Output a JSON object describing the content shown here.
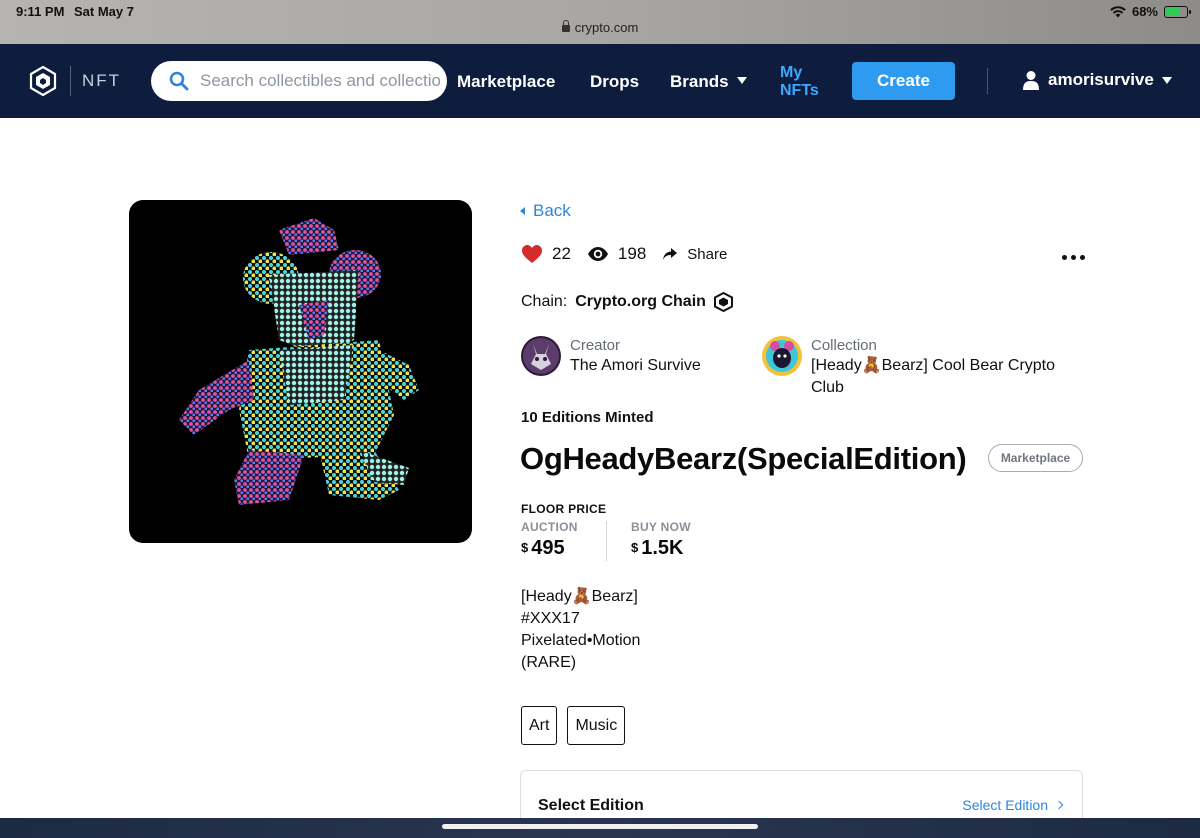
{
  "status_bar": {
    "time": "9:11 PM",
    "date": "Sat May 7",
    "url": "crypto.com",
    "battery": "68%",
    "battery_level": 0.68
  },
  "nav": {
    "brand": "NFT",
    "search_placeholder": "Search collectibles and collections",
    "links": {
      "marketplace": "Marketplace",
      "drops": "Drops",
      "brands": "Brands",
      "my_nfts": "My NFTs"
    },
    "create_label": "Create",
    "username": "amorisurvive"
  },
  "nft": {
    "back_label": "Back",
    "likes": "22",
    "views": "198",
    "share_label": "Share",
    "chain_label": "Chain:",
    "chain_value": "Crypto.org Chain",
    "creator_role": "Creator",
    "creator_name": "The Amori Survive",
    "collection_role": "Collection",
    "collection_name": "[Heady🧸Bearz] Cool Bear Crypto Club",
    "editions_minted": "10 Editions Minted",
    "title": "OgHeadyBearz(SpecialEdition)",
    "badge": "Marketplace",
    "floor_price_label": "FLOOR PRICE",
    "auction_label": "AUCTION",
    "auction_currency": "$",
    "auction_value": "495",
    "buy_now_label": "BUY NOW",
    "buy_now_currency": "$",
    "buy_now_value": "1.5K",
    "description": [
      "[Heady🧸Bearz]",
      "#XXX17",
      "Pixelated•Motion",
      "(RARE)"
    ],
    "tags": [
      "Art",
      "Music"
    ],
    "select_edition_label": "Select Edition",
    "select_edition_link": "Select Edition"
  },
  "colors": {
    "nav_bg": "#0e1d3e",
    "accent": "#2f9bf0",
    "link": "#2f86d8",
    "heart": "#d42b2b"
  }
}
